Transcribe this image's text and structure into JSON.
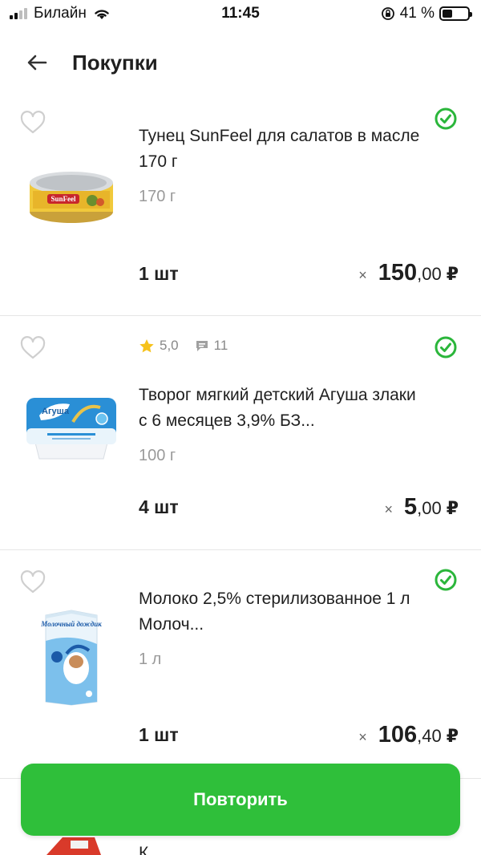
{
  "status": {
    "carrier": "Билайн",
    "time": "11:45",
    "battery": "41 %",
    "battery_level": 0.41
  },
  "header": {
    "title": "Покупки"
  },
  "items": [
    {
      "name": "Тунец SunFeel для салатов в масле 170 г",
      "weight": "170 г",
      "qty": "1 шт",
      "times": "×",
      "price_int": "150",
      "price_frac": ",00",
      "currency": "₽",
      "thumb_label": "SunFeel"
    },
    {
      "rating": "5,0",
      "reviews": "11",
      "name": "Творог мягкий детский Агуша злаки с 6 месяцев 3,9% БЗ...",
      "weight": "100 г",
      "qty": "4 шт",
      "times": "×",
      "price_int": "5",
      "price_frac": ",00",
      "currency": "₽",
      "thumb_label": "Агуша"
    },
    {
      "name": "Молоко 2,5% стерилизованное 1 л Молоч...",
      "weight": "1 л",
      "qty": "1 шт",
      "times": "×",
      "price_int": "106",
      "price_frac": ",40",
      "currency": "₽",
      "thumb_label": "Молочный дождик"
    }
  ],
  "repeat_button": "Повторить",
  "peek_text": "К...",
  "colors": {
    "accent": "#2fbf3a",
    "check": "#2bb63b",
    "star": "#f6c21c"
  }
}
